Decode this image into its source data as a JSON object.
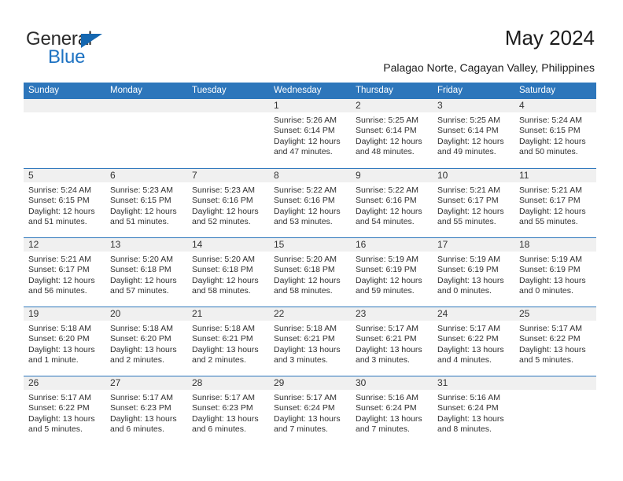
{
  "brand": {
    "name_part1": "General",
    "name_part2": "Blue",
    "color_blue": "#1d72c2",
    "triangle_color": "#1567b0"
  },
  "header": {
    "title": "May 2024",
    "subtitle": "Palagao Norte, Cagayan Valley, Philippines"
  },
  "calendar": {
    "header_bg": "#2d76bb",
    "weekdays": [
      "Sunday",
      "Monday",
      "Tuesday",
      "Wednesday",
      "Thursday",
      "Friday",
      "Saturday"
    ],
    "weeks": [
      [
        {
          "day": "",
          "sunrise": "",
          "sunset": "",
          "daylight1": "",
          "daylight2": ""
        },
        {
          "day": "",
          "sunrise": "",
          "sunset": "",
          "daylight1": "",
          "daylight2": ""
        },
        {
          "day": "",
          "sunrise": "",
          "sunset": "",
          "daylight1": "",
          "daylight2": ""
        },
        {
          "day": "1",
          "sunrise": "Sunrise: 5:26 AM",
          "sunset": "Sunset: 6:14 PM",
          "daylight1": "Daylight: 12 hours",
          "daylight2": "and 47 minutes."
        },
        {
          "day": "2",
          "sunrise": "Sunrise: 5:25 AM",
          "sunset": "Sunset: 6:14 PM",
          "daylight1": "Daylight: 12 hours",
          "daylight2": "and 48 minutes."
        },
        {
          "day": "3",
          "sunrise": "Sunrise: 5:25 AM",
          "sunset": "Sunset: 6:14 PM",
          "daylight1": "Daylight: 12 hours",
          "daylight2": "and 49 minutes."
        },
        {
          "day": "4",
          "sunrise": "Sunrise: 5:24 AM",
          "sunset": "Sunset: 6:15 PM",
          "daylight1": "Daylight: 12 hours",
          "daylight2": "and 50 minutes."
        }
      ],
      [
        {
          "day": "5",
          "sunrise": "Sunrise: 5:24 AM",
          "sunset": "Sunset: 6:15 PM",
          "daylight1": "Daylight: 12 hours",
          "daylight2": "and 51 minutes."
        },
        {
          "day": "6",
          "sunrise": "Sunrise: 5:23 AM",
          "sunset": "Sunset: 6:15 PM",
          "daylight1": "Daylight: 12 hours",
          "daylight2": "and 51 minutes."
        },
        {
          "day": "7",
          "sunrise": "Sunrise: 5:23 AM",
          "sunset": "Sunset: 6:16 PM",
          "daylight1": "Daylight: 12 hours",
          "daylight2": "and 52 minutes."
        },
        {
          "day": "8",
          "sunrise": "Sunrise: 5:22 AM",
          "sunset": "Sunset: 6:16 PM",
          "daylight1": "Daylight: 12 hours",
          "daylight2": "and 53 minutes."
        },
        {
          "day": "9",
          "sunrise": "Sunrise: 5:22 AM",
          "sunset": "Sunset: 6:16 PM",
          "daylight1": "Daylight: 12 hours",
          "daylight2": "and 54 minutes."
        },
        {
          "day": "10",
          "sunrise": "Sunrise: 5:21 AM",
          "sunset": "Sunset: 6:17 PM",
          "daylight1": "Daylight: 12 hours",
          "daylight2": "and 55 minutes."
        },
        {
          "day": "11",
          "sunrise": "Sunrise: 5:21 AM",
          "sunset": "Sunset: 6:17 PM",
          "daylight1": "Daylight: 12 hours",
          "daylight2": "and 55 minutes."
        }
      ],
      [
        {
          "day": "12",
          "sunrise": "Sunrise: 5:21 AM",
          "sunset": "Sunset: 6:17 PM",
          "daylight1": "Daylight: 12 hours",
          "daylight2": "and 56 minutes."
        },
        {
          "day": "13",
          "sunrise": "Sunrise: 5:20 AM",
          "sunset": "Sunset: 6:18 PM",
          "daylight1": "Daylight: 12 hours",
          "daylight2": "and 57 minutes."
        },
        {
          "day": "14",
          "sunrise": "Sunrise: 5:20 AM",
          "sunset": "Sunset: 6:18 PM",
          "daylight1": "Daylight: 12 hours",
          "daylight2": "and 58 minutes."
        },
        {
          "day": "15",
          "sunrise": "Sunrise: 5:20 AM",
          "sunset": "Sunset: 6:18 PM",
          "daylight1": "Daylight: 12 hours",
          "daylight2": "and 58 minutes."
        },
        {
          "day": "16",
          "sunrise": "Sunrise: 5:19 AM",
          "sunset": "Sunset: 6:19 PM",
          "daylight1": "Daylight: 12 hours",
          "daylight2": "and 59 minutes."
        },
        {
          "day": "17",
          "sunrise": "Sunrise: 5:19 AM",
          "sunset": "Sunset: 6:19 PM",
          "daylight1": "Daylight: 13 hours",
          "daylight2": "and 0 minutes."
        },
        {
          "day": "18",
          "sunrise": "Sunrise: 5:19 AM",
          "sunset": "Sunset: 6:19 PM",
          "daylight1": "Daylight: 13 hours",
          "daylight2": "and 0 minutes."
        }
      ],
      [
        {
          "day": "19",
          "sunrise": "Sunrise: 5:18 AM",
          "sunset": "Sunset: 6:20 PM",
          "daylight1": "Daylight: 13 hours",
          "daylight2": "and 1 minute."
        },
        {
          "day": "20",
          "sunrise": "Sunrise: 5:18 AM",
          "sunset": "Sunset: 6:20 PM",
          "daylight1": "Daylight: 13 hours",
          "daylight2": "and 2 minutes."
        },
        {
          "day": "21",
          "sunrise": "Sunrise: 5:18 AM",
          "sunset": "Sunset: 6:21 PM",
          "daylight1": "Daylight: 13 hours",
          "daylight2": "and 2 minutes."
        },
        {
          "day": "22",
          "sunrise": "Sunrise: 5:18 AM",
          "sunset": "Sunset: 6:21 PM",
          "daylight1": "Daylight: 13 hours",
          "daylight2": "and 3 minutes."
        },
        {
          "day": "23",
          "sunrise": "Sunrise: 5:17 AM",
          "sunset": "Sunset: 6:21 PM",
          "daylight1": "Daylight: 13 hours",
          "daylight2": "and 3 minutes."
        },
        {
          "day": "24",
          "sunrise": "Sunrise: 5:17 AM",
          "sunset": "Sunset: 6:22 PM",
          "daylight1": "Daylight: 13 hours",
          "daylight2": "and 4 minutes."
        },
        {
          "day": "25",
          "sunrise": "Sunrise: 5:17 AM",
          "sunset": "Sunset: 6:22 PM",
          "daylight1": "Daylight: 13 hours",
          "daylight2": "and 5 minutes."
        }
      ],
      [
        {
          "day": "26",
          "sunrise": "Sunrise: 5:17 AM",
          "sunset": "Sunset: 6:22 PM",
          "daylight1": "Daylight: 13 hours",
          "daylight2": "and 5 minutes."
        },
        {
          "day": "27",
          "sunrise": "Sunrise: 5:17 AM",
          "sunset": "Sunset: 6:23 PM",
          "daylight1": "Daylight: 13 hours",
          "daylight2": "and 6 minutes."
        },
        {
          "day": "28",
          "sunrise": "Sunrise: 5:17 AM",
          "sunset": "Sunset: 6:23 PM",
          "daylight1": "Daylight: 13 hours",
          "daylight2": "and 6 minutes."
        },
        {
          "day": "29",
          "sunrise": "Sunrise: 5:17 AM",
          "sunset": "Sunset: 6:24 PM",
          "daylight1": "Daylight: 13 hours",
          "daylight2": "and 7 minutes."
        },
        {
          "day": "30",
          "sunrise": "Sunrise: 5:16 AM",
          "sunset": "Sunset: 6:24 PM",
          "daylight1": "Daylight: 13 hours",
          "daylight2": "and 7 minutes."
        },
        {
          "day": "31",
          "sunrise": "Sunrise: 5:16 AM",
          "sunset": "Sunset: 6:24 PM",
          "daylight1": "Daylight: 13 hours",
          "daylight2": "and 8 minutes."
        },
        {
          "day": "",
          "sunrise": "",
          "sunset": "",
          "daylight1": "",
          "daylight2": ""
        }
      ]
    ]
  }
}
